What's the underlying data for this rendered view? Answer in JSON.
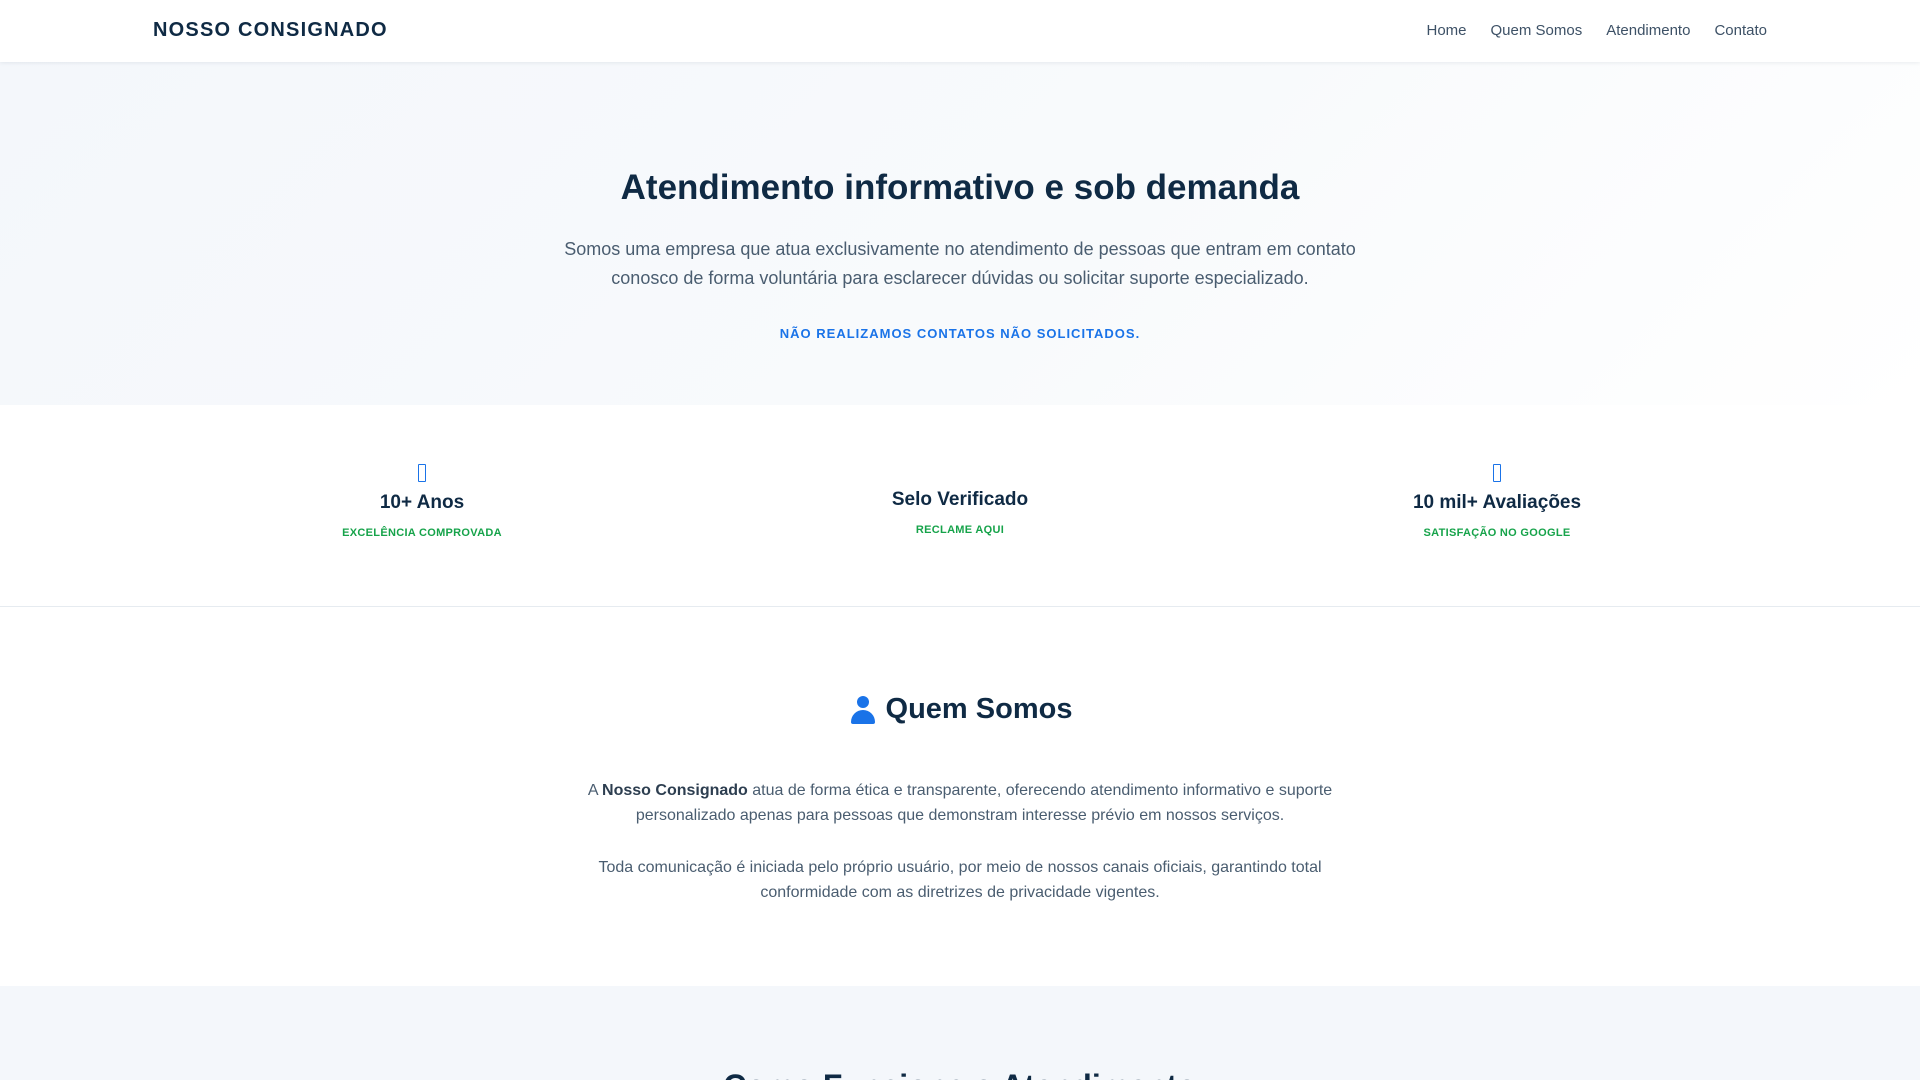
{
  "header": {
    "brand": "NOSSO CONSIGNADO",
    "nav": [
      "Home",
      "Quem Somos",
      "Atendimento",
      "Contato"
    ]
  },
  "hero": {
    "title": "Atendimento informativo e sob demanda",
    "text": "Somos uma empresa que atua exclusivamente no atendimento de pessoas que entram em contato conosco de forma voluntária para esclarecer dúvidas ou solicitar suporte especializado.",
    "note": "NÃO REALIZAMOS CONTATOS NÃO SOLICITADOS."
  },
  "stats": [
    {
      "icon": "unknown-icon",
      "title": "10+ Anos",
      "subtitle": "EXCELÊNCIA COMPROVADA"
    },
    {
      "title": "Selo Verificado",
      "subtitle": "RECLAME AQUI"
    },
    {
      "icon": "unknown-icon",
      "title": "10 mil+ Avaliações",
      "subtitle": "SATISFAÇÃO NO GOOGLE"
    }
  ],
  "about": {
    "icon": "user-icon",
    "title": "Quem Somos",
    "p1_prefix": "A ",
    "p1_bold": "Nosso Consignado",
    "p1_rest": " atua de forma ética e transparente, oferecendo atendimento informativo e suporte personalizado apenas para pessoas que demonstram interesse prévio em nossos serviços.",
    "p2": "Toda comunicação é iniciada pelo próprio usuário, por meio de nossos canais oficiais, garantindo total conformidade com as diretrizes de privacidade vigentes."
  },
  "next_section": {
    "title": "Como Funciona o Atendimento"
  },
  "colors": {
    "primary_text": "#0f2a44",
    "accent_blue": "#1a73e8",
    "accent_green": "#16a34a",
    "hero_bg": "#f4f7fb"
  }
}
